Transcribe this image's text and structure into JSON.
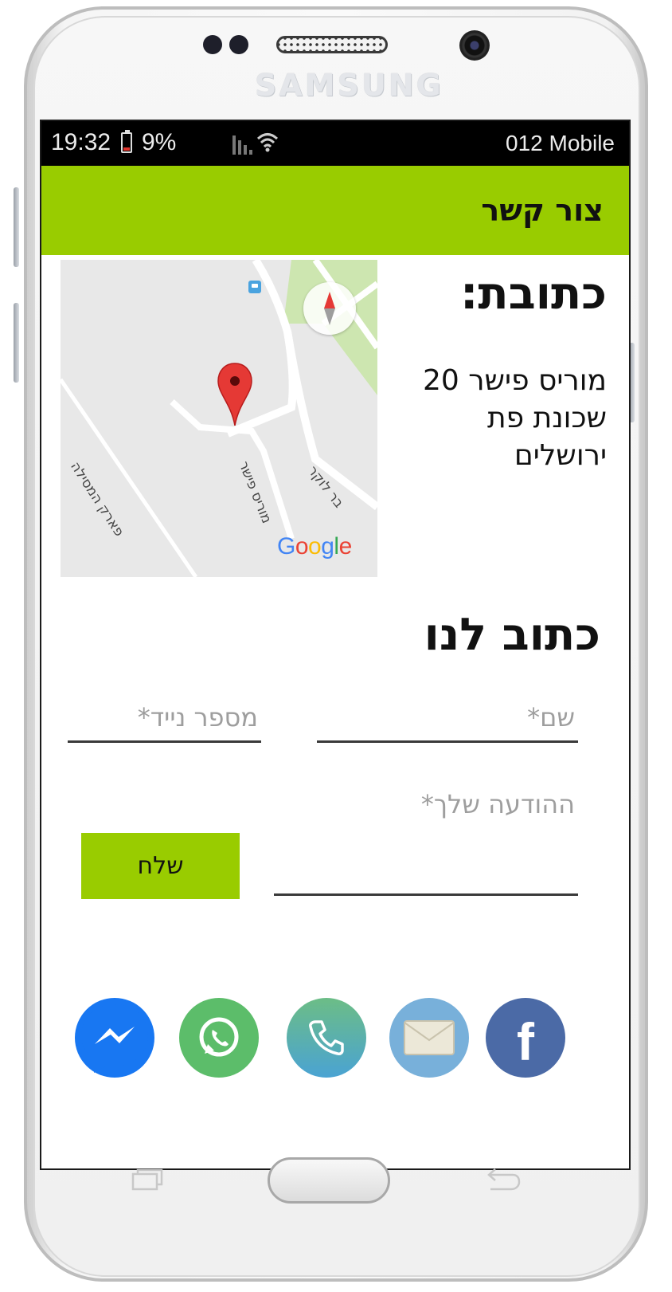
{
  "device": {
    "brand": "SAMSUNG"
  },
  "status_bar": {
    "time": "19:32",
    "battery": "9%",
    "carrier": "012 Mobile"
  },
  "app_bar": {
    "title": "צור קשר"
  },
  "map": {
    "streets": [
      "פארק המסילה",
      "מוריס פישר",
      "בר לוקר"
    ],
    "provider": "Google",
    "compass_icon": "compass-icon",
    "pin_icon": "map-pin-icon"
  },
  "address": {
    "heading": "כתובת:",
    "lines": [
      "מוריס פישר 20",
      "שכונת פת",
      "ירושלים"
    ]
  },
  "contact_form": {
    "heading": "כתוב לנו",
    "name_placeholder": "שם*",
    "phone_placeholder": "מספר נייד*",
    "message_placeholder": "ההודעה שלך*",
    "send_label": "שלח"
  },
  "social": [
    {
      "name": "messenger",
      "icon": "messenger-icon",
      "color": "#1877f2"
    },
    {
      "name": "whatsapp",
      "icon": "whatsapp-icon",
      "color": "#5cbd6a"
    },
    {
      "name": "call",
      "icon": "phone-icon",
      "color": "#4aa3d3"
    },
    {
      "name": "email",
      "icon": "envelope-icon",
      "color": "#78b0da"
    },
    {
      "name": "facebook",
      "icon": "facebook-icon",
      "color": "#4b6aa6",
      "glyph": "f"
    }
  ],
  "theme": {
    "accent": "#99cc00"
  }
}
